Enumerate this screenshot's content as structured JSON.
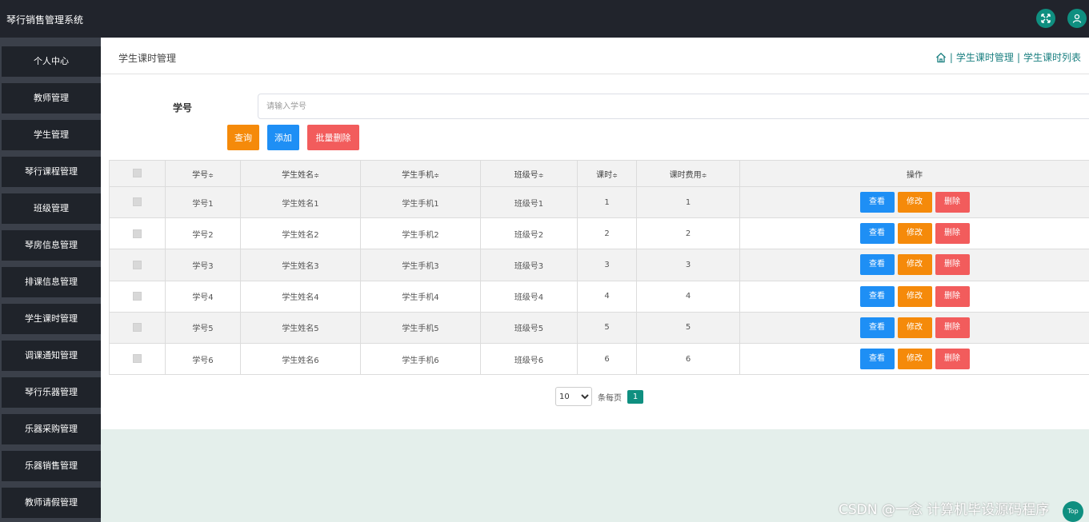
{
  "app": {
    "title": "琴行销售管理系统"
  },
  "topbar": {
    "fullscreen_icon": "expand-icon",
    "user_icon": "user-icon"
  },
  "sidebar": {
    "items": [
      {
        "label": "个人中心"
      },
      {
        "label": "教师管理"
      },
      {
        "label": "学生管理"
      },
      {
        "label": "琴行课程管理"
      },
      {
        "label": "班级管理"
      },
      {
        "label": "琴房信息管理"
      },
      {
        "label": "排课信息管理"
      },
      {
        "label": "学生课时管理"
      },
      {
        "label": "调课通知管理"
      },
      {
        "label": "琴行乐器管理"
      },
      {
        "label": "乐器采购管理"
      },
      {
        "label": "乐器销售管理"
      },
      {
        "label": "教师请假管理"
      }
    ]
  },
  "page": {
    "title": "学生课时管理",
    "breadcrumb": [
      "学生课时管理",
      "学生课时列表"
    ],
    "breadcrumb_sep": "|"
  },
  "search": {
    "label": "学号",
    "placeholder": "请输入学号",
    "value": ""
  },
  "toolbar": {
    "search_label": "查询",
    "add_label": "添加",
    "batch_delete_label": "批量删除"
  },
  "table": {
    "columns": [
      "学号",
      "学生姓名",
      "学生手机",
      "班级号",
      "课时",
      "课时费用"
    ],
    "sort_icon": "≑",
    "operation_header": "操作",
    "rows": [
      {
        "student_no": "学号1",
        "name": "学生姓名1",
        "phone": "学生手机1",
        "class_no": "班级号1",
        "hours": "1",
        "fee": "1"
      },
      {
        "student_no": "学号2",
        "name": "学生姓名2",
        "phone": "学生手机2",
        "class_no": "班级号2",
        "hours": "2",
        "fee": "2"
      },
      {
        "student_no": "学号3",
        "name": "学生姓名3",
        "phone": "学生手机3",
        "class_no": "班级号3",
        "hours": "3",
        "fee": "3"
      },
      {
        "student_no": "学号4",
        "name": "学生姓名4",
        "phone": "学生手机4",
        "class_no": "班级号4",
        "hours": "4",
        "fee": "4"
      },
      {
        "student_no": "学号5",
        "name": "学生姓名5",
        "phone": "学生手机5",
        "class_no": "班级号5",
        "hours": "5",
        "fee": "5"
      },
      {
        "student_no": "学号6",
        "name": "学生姓名6",
        "phone": "学生手机6",
        "class_no": "班级号6",
        "hours": "6",
        "fee": "6"
      }
    ],
    "actions": {
      "view": "查看",
      "edit": "修改",
      "delete": "删除"
    }
  },
  "pagination": {
    "page_size": "10",
    "per_page_label": "条每页",
    "current_page": "1"
  },
  "watermark": "CSDN @一念 计算机毕设源码程序",
  "back_to_top": "Top",
  "colors": {
    "accent": "#0f8f80",
    "sidebar": "#1f232a",
    "topbar": "#21242c",
    "view": "#1e8ff5",
    "edit": "#f58a0a",
    "delete": "#f25c5c"
  }
}
